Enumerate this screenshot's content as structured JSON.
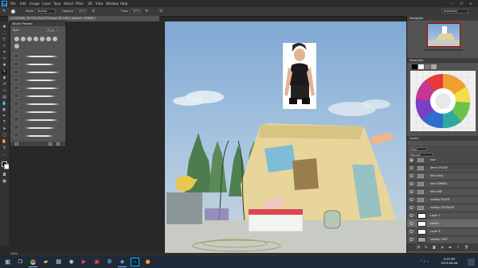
{
  "app": {
    "logo_text": "Ps"
  },
  "menu": [
    "File",
    "Edit",
    "Image",
    "Layer",
    "Type",
    "Select",
    "Filter",
    "3D",
    "View",
    "Window",
    "Help"
  ],
  "options_bar": {
    "mode_label": "Mode:",
    "mode_value": "Normal",
    "opacity_label": "Opacity:",
    "opacity_value": "100%",
    "flow_label": "Flow:",
    "flow_value": "100%",
    "workspace": "Essentials"
  },
  "document": {
    "tab_title": "LOCATION_TATTOO ROOFTOP.psd @ 100% (sketch, RGB/8) *",
    "zoom": "100%"
  },
  "brush_panel": {
    "title": "Brush Presets",
    "size_label": "Size:",
    "size_value": "25 px"
  },
  "navigator": {
    "title": "Navigator"
  },
  "swatches": {
    "title": "Swatches"
  },
  "layers": {
    "title": "Layers",
    "kind": "Kind",
    "blend_mode": "Normal",
    "items": [
      {
        "name": "roof",
        "type": "folder",
        "selected": false
      },
      {
        "name": "items FRONT",
        "type": "folder",
        "selected": false
      },
      {
        "name": "tent relax",
        "type": "folder",
        "selected": false
      },
      {
        "name": "tent TUNNEL",
        "type": "folder",
        "selected": false
      },
      {
        "name": "tent ONE",
        "type": "folder",
        "selected": false
      },
      {
        "name": "rooftop FRONT",
        "type": "folder",
        "selected": false
      },
      {
        "name": "rooftop DISTANCE",
        "type": "folder",
        "selected": false
      },
      {
        "name": "Layer 7",
        "type": "layer",
        "selected": false
      },
      {
        "name": "sketch",
        "type": "layer",
        "selected": true
      },
      {
        "name": "Layer 6",
        "type": "layer",
        "selected": false
      },
      {
        "name": "rooftop CNST",
        "type": "layer",
        "selected": false
      }
    ]
  },
  "taskbar": {
    "time": "4:25 PM",
    "date": "2019-06-06"
  },
  "colors": {
    "menubar": "#2b2b2b",
    "panel": "#535353",
    "canvas_sky": "#8fb3d8",
    "taskbar": "#1f2a38",
    "accent": "#31a8ff"
  }
}
